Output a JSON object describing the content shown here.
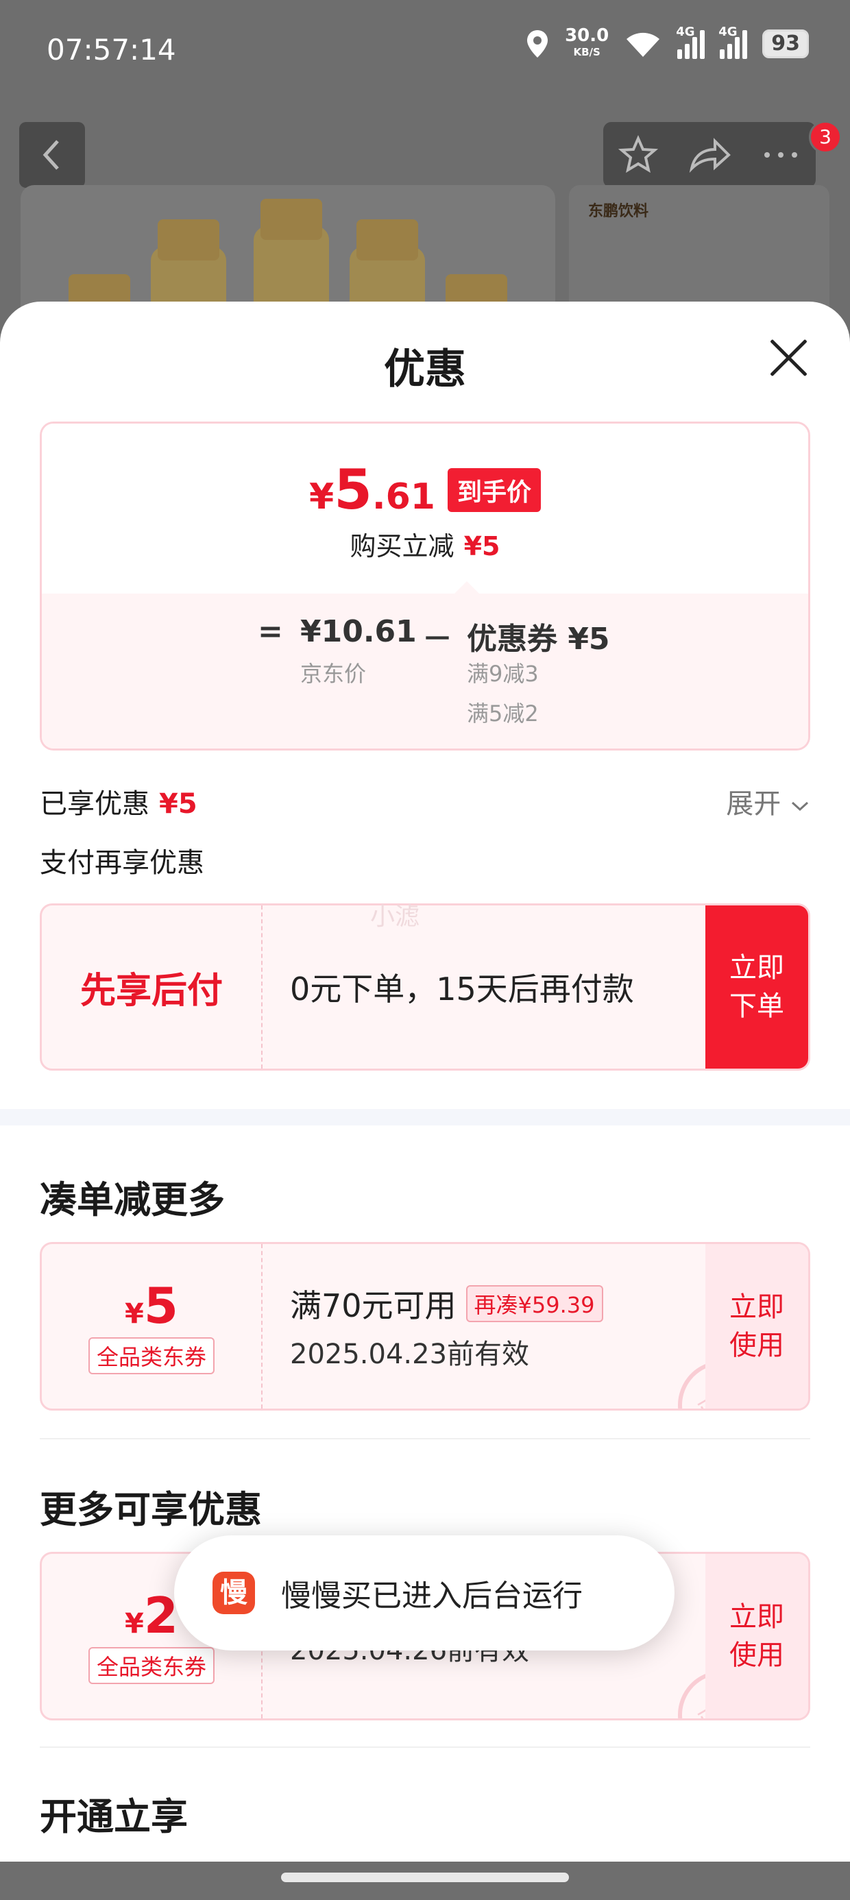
{
  "status_bar": {
    "time": "07:57:14",
    "speed": "30.0",
    "speed_unit": "KB/S",
    "net1": "4G",
    "net2": "4G",
    "battery": "93"
  },
  "background_page": {
    "badge_count": "3",
    "brand_text": "东鹏饮料"
  },
  "sheet": {
    "title": "优惠",
    "price_card": {
      "currency": "¥",
      "price_int": "5",
      "price_dec": ".61",
      "tag": "到手价",
      "reduce_label": "购买立减",
      "reduce_amount": "¥5",
      "calc": {
        "equals": "=",
        "jd_price": "¥10.61",
        "jd_label": "京东价",
        "minus": "－",
        "coupon_label": "优惠券 ¥5",
        "coupon_rule1": "满9减3",
        "coupon_rule2": "满5减2"
      }
    },
    "enjoyed_label": "已享优惠",
    "enjoyed_amount": "¥5",
    "expand_label": "展开",
    "pay_title": "支付再享优惠",
    "watermark": "小滤",
    "pay_card": {
      "name": "先享后付",
      "desc": "0元下单，15天后再付款",
      "button": "立即\n下单"
    },
    "section1_title": "凑单减更多",
    "coupon1": {
      "currency": "¥",
      "value": "5",
      "kind": "全品类东券",
      "condition": "满70元可用",
      "more_tag": "再凑¥59.39",
      "expiry": "2025.04.23前有效",
      "button": "立即\n使用",
      "stamp": "已领"
    },
    "section2_title": "更多可享优惠",
    "coupon2": {
      "currency": "¥",
      "value": "2",
      "kind": "全品类东券",
      "expiry": "2025.04.26前有效",
      "button": "立即\n使用",
      "stamp": "已领"
    },
    "section3_title": "开通立享",
    "toast": {
      "icon": "慢",
      "text": "慢慢买已进入后台运行"
    }
  }
}
